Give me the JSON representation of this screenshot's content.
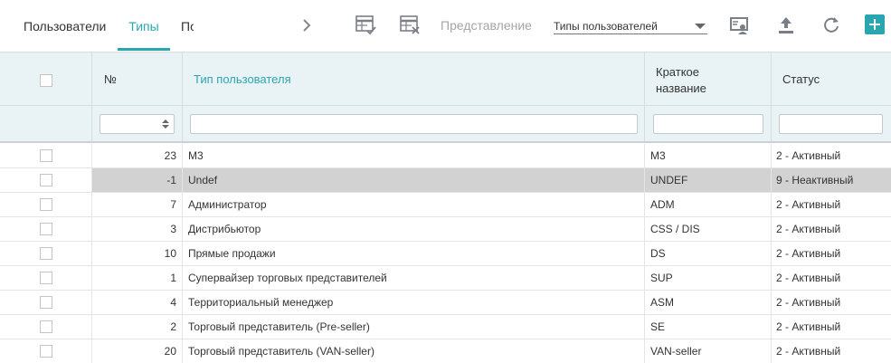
{
  "tabs": [
    {
      "label": "Пользователи",
      "active": false
    },
    {
      "label": "Типы",
      "active": true
    },
    {
      "label": "По",
      "active": false
    }
  ],
  "toolbar": {
    "view_label": "Представление",
    "view_value": "Типы пользователей",
    "icons": [
      "chevron-right-icon",
      "table-check-icon",
      "table-delete-icon",
      "user-card-icon",
      "upload-icon",
      "refresh-icon",
      "plus-icon"
    ]
  },
  "grid": {
    "columns": {
      "num": "№",
      "type": "Тип пользователя",
      "short": "Краткое название",
      "status": "Статус"
    },
    "rows": [
      {
        "id": "23",
        "name": "M3",
        "short": "M3",
        "status": "2 - Активный",
        "selected": false
      },
      {
        "id": "-1",
        "name": "Undef",
        "short": "UNDEF",
        "status": "9 - Неактивный",
        "selected": true
      },
      {
        "id": "7",
        "name": "Администратор",
        "short": "ADM",
        "status": "2 - Активный",
        "selected": false
      },
      {
        "id": "3",
        "name": "Дистрибьютор",
        "short": "CSS / DIS",
        "status": "2 - Активный",
        "selected": false
      },
      {
        "id": "10",
        "name": "Прямые продажи",
        "short": "DS",
        "status": "2 - Активный",
        "selected": false
      },
      {
        "id": "1",
        "name": "Супервайзер торговых представителей",
        "short": "SUP",
        "status": "2 - Активный",
        "selected": false
      },
      {
        "id": "4",
        "name": "Территориальный менеджер",
        "short": "ASM",
        "status": "2 - Активный",
        "selected": false
      },
      {
        "id": "2",
        "name": "Торговый представитель (Pre-seller)",
        "short": "SE",
        "status": "2 - Активный",
        "selected": false
      },
      {
        "id": "20",
        "name": "Торговый представитель (VAN-seller)",
        "short": "VAN-seller",
        "status": "2 - Активный",
        "selected": false
      }
    ]
  },
  "colors": {
    "accent": "#2aa6b0",
    "header_bg": "#e9f3f6",
    "selected_row": "#d2d2d2"
  }
}
